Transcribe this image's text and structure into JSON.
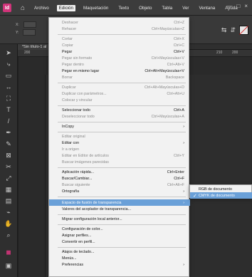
{
  "app": {
    "logo_text": "Id",
    "home_icon": "home-icon"
  },
  "menubar": {
    "items": [
      "Archivo",
      "Edición",
      "Maquetación",
      "Texto",
      "Objeto",
      "Tabla",
      "Ver",
      "Ventana",
      "Ayuda"
    ],
    "active_index": 1
  },
  "document": {
    "tab_label": "*Sin título-1 al"
  },
  "ruler": {
    "left_value": "200",
    "r1_value": "210",
    "r2_value": "200"
  },
  "menus": {
    "edit": {
      "items": [
        {
          "label": "Deshacer",
          "shortcut": "Ctrl+Z",
          "disabled": true
        },
        {
          "label": "Rehacer",
          "shortcut": "Ctrl+Mayúsculas+Z",
          "disabled": true
        },
        {
          "type": "separator"
        },
        {
          "label": "Cortar",
          "shortcut": "Ctrl+X",
          "disabled": true
        },
        {
          "label": "Copiar",
          "shortcut": "Ctrl+C",
          "disabled": true
        },
        {
          "label": "Pegar",
          "shortcut": "Ctrl+V",
          "disabled": false
        },
        {
          "label": "Pegar sin formato",
          "shortcut": "Ctrl+Mayúsculas+V",
          "disabled": true
        },
        {
          "label": "Pegar dentro",
          "shortcut": "Ctrl+Alt+V",
          "disabled": true
        },
        {
          "label": "Pegar en mismo lugar",
          "shortcut": "Ctrl+Alt+Mayúsculas+V",
          "disabled": false
        },
        {
          "label": "Borrar",
          "shortcut": "Backspace",
          "disabled": true
        },
        {
          "type": "separator"
        },
        {
          "label": "Duplicar",
          "shortcut": "Ctrl+Alt+Mayúsculas+D",
          "disabled": true
        },
        {
          "label": "Duplicar con parámetros...",
          "shortcut": "Ctrl+Alt+U",
          "disabled": true
        },
        {
          "label": "Colocar y vincular",
          "shortcut": "",
          "disabled": true
        },
        {
          "type": "separator"
        },
        {
          "label": "Seleccionar todo",
          "shortcut": "Ctrl+A",
          "disabled": false
        },
        {
          "label": "Deseleccionar todo",
          "shortcut": "Ctrl+Mayúsculas+A",
          "disabled": true
        },
        {
          "type": "separator"
        },
        {
          "label": "InCopy",
          "shortcut": "",
          "disabled": false,
          "submenu": true
        },
        {
          "type": "separator"
        },
        {
          "label": "Editar original",
          "shortcut": "",
          "disabled": true
        },
        {
          "label": "Editar con",
          "shortcut": "",
          "disabled": false,
          "submenu": true
        },
        {
          "label": "Ir a origen",
          "shortcut": "",
          "disabled": true
        },
        {
          "label": "Editar en Editor de artículos",
          "shortcut": "Ctrl+Y",
          "disabled": true
        },
        {
          "label": "Buscar imágenes parecidas",
          "shortcut": "",
          "disabled": true
        },
        {
          "type": "separator"
        },
        {
          "label": "Aplicación rápida...",
          "shortcut": "Ctrl+Enter",
          "disabled": false
        },
        {
          "label": "Buscar/Cambiar...",
          "shortcut": "Ctrl+F",
          "disabled": false
        },
        {
          "label": "Buscar siguiente",
          "shortcut": "Ctrl+Alt+F",
          "disabled": true
        },
        {
          "label": "Ortografía",
          "shortcut": "",
          "disabled": false,
          "submenu": true
        },
        {
          "type": "separator"
        },
        {
          "label": "Espacio de fusión de transparencia",
          "shortcut": "",
          "disabled": false,
          "submenu": true,
          "highlight": true
        },
        {
          "label": "Valores del acoplador de transparencia...",
          "shortcut": "",
          "disabled": false
        },
        {
          "type": "separator"
        },
        {
          "label": "Migrar configuración local anterior...",
          "shortcut": "",
          "disabled": false
        },
        {
          "type": "separator"
        },
        {
          "label": "Configuración de color...",
          "shortcut": "",
          "disabled": false
        },
        {
          "label": "Asignar perfiles...",
          "shortcut": "",
          "disabled": false
        },
        {
          "label": "Convertir en perfil...",
          "shortcut": "",
          "disabled": false
        },
        {
          "type": "separator"
        },
        {
          "label": "Atajos de teclado...",
          "shortcut": "",
          "disabled": false
        },
        {
          "label": "Menús...",
          "shortcut": "",
          "disabled": false
        },
        {
          "label": "Preferencias",
          "shortcut": "",
          "disabled": false,
          "submenu": true
        }
      ]
    },
    "transparency_blend_space_submenu": {
      "items": [
        {
          "label": "RGB de documento",
          "selected": false
        },
        {
          "label": "CMYK de documento",
          "selected": true
        }
      ]
    }
  },
  "colors": {
    "highlight": "#6aa0d8",
    "app_accent": "#d1347a"
  }
}
